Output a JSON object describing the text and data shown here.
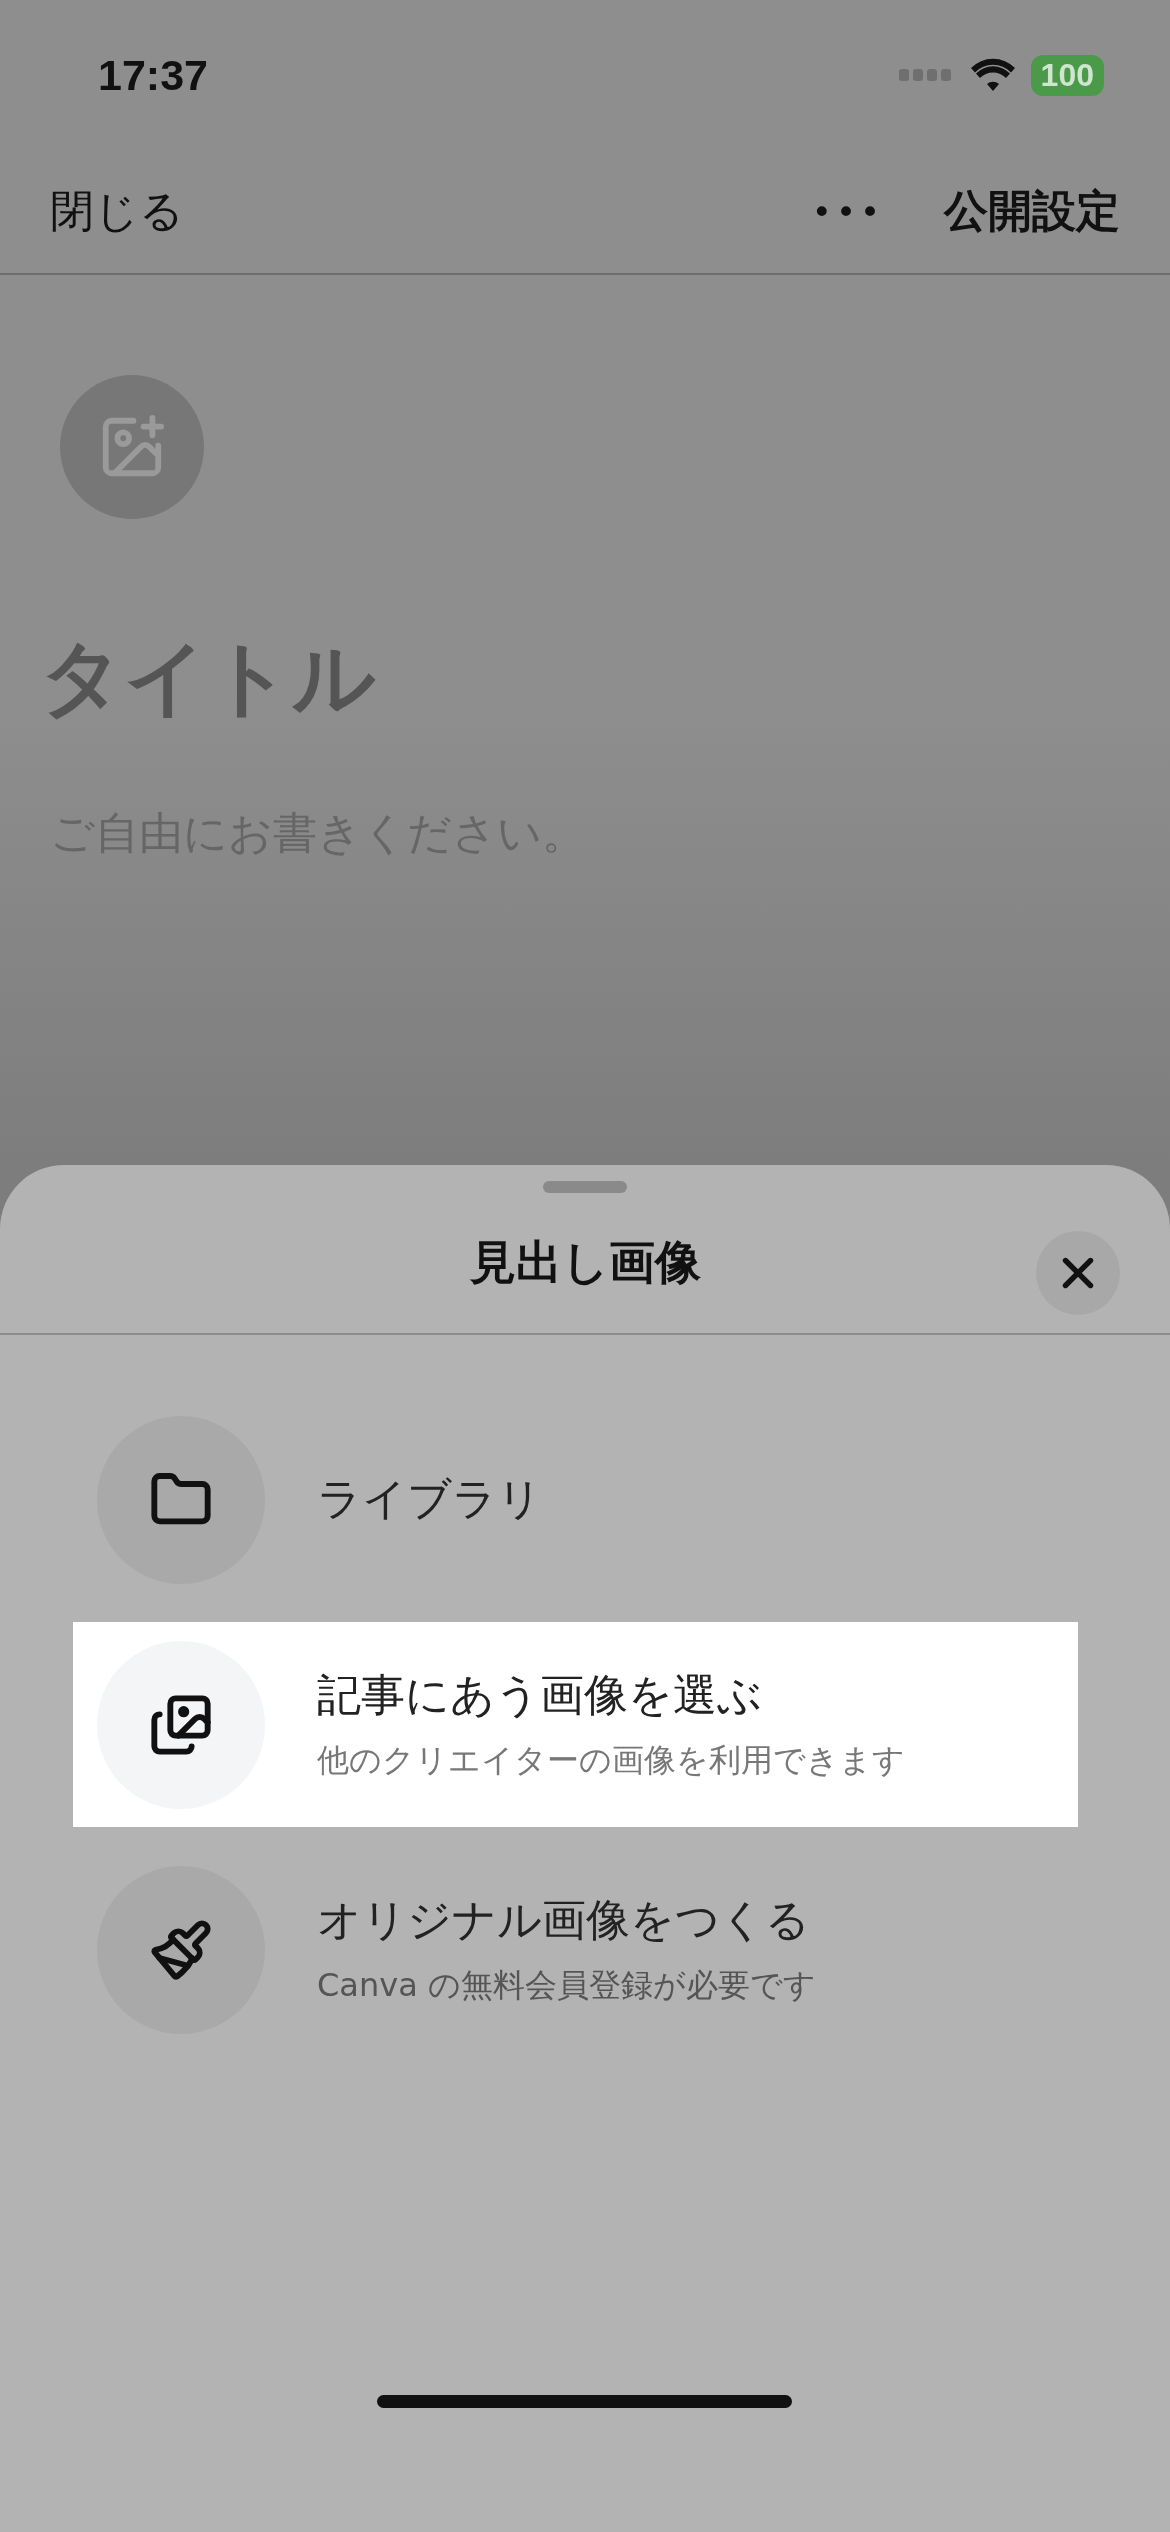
{
  "status_bar": {
    "time": "17:37",
    "battery": "100"
  },
  "nav": {
    "close": "閉じる",
    "more": "•••",
    "publish": "公開設定"
  },
  "editor": {
    "title_placeholder": "タイトル",
    "body_placeholder": "ご自由にお書きください。"
  },
  "sheet": {
    "title": "見出し画像",
    "options": [
      {
        "kind": "folder",
        "label": "ライブラリ",
        "selected": false
      },
      {
        "kind": "images",
        "label": "記事にあう画像を選ぶ",
        "description": "他のクリエイターの画像を利用できます",
        "selected": true
      },
      {
        "kind": "brush",
        "label": "オリジナル画像をつくる",
        "description": "Canva の無料会員登録が必要です",
        "selected": false
      }
    ]
  }
}
